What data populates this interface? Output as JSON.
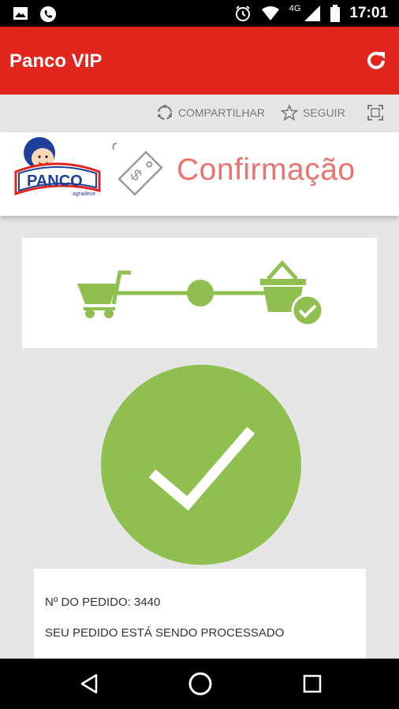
{
  "status_bar": {
    "time": "17:01",
    "network": "4G",
    "icons": [
      "image-icon",
      "phone-icon",
      "alarm-icon",
      "wifi-icon",
      "signal-icon",
      "battery-icon"
    ]
  },
  "app_bar": {
    "title": "Panco VIP",
    "refresh_icon": "refresh-icon"
  },
  "toolbar": {
    "share_label": "COMPARTILHAR",
    "follow_label": "SEGUIR",
    "fullscreen_icon": "fullscreen-icon"
  },
  "header": {
    "logo_text": "PANCO",
    "logo_subtext": "agradece",
    "title": "Confirmação"
  },
  "progress": {
    "icons": [
      "cart-icon",
      "step-dot-icon",
      "basket-check-icon"
    ],
    "accent_color": "#8fbf4f"
  },
  "order": {
    "number_line": "Nº DO PEDIDO: 3440",
    "status_line": "SEU PEDIDO ESTÁ SENDO PROCESSADO"
  },
  "nav_bar": {
    "icons": [
      "back-icon",
      "home-icon",
      "recents-icon"
    ]
  },
  "colors": {
    "app_bar": "#e0261d",
    "title_accent": "#e9736f",
    "success": "#8fbf4f"
  }
}
